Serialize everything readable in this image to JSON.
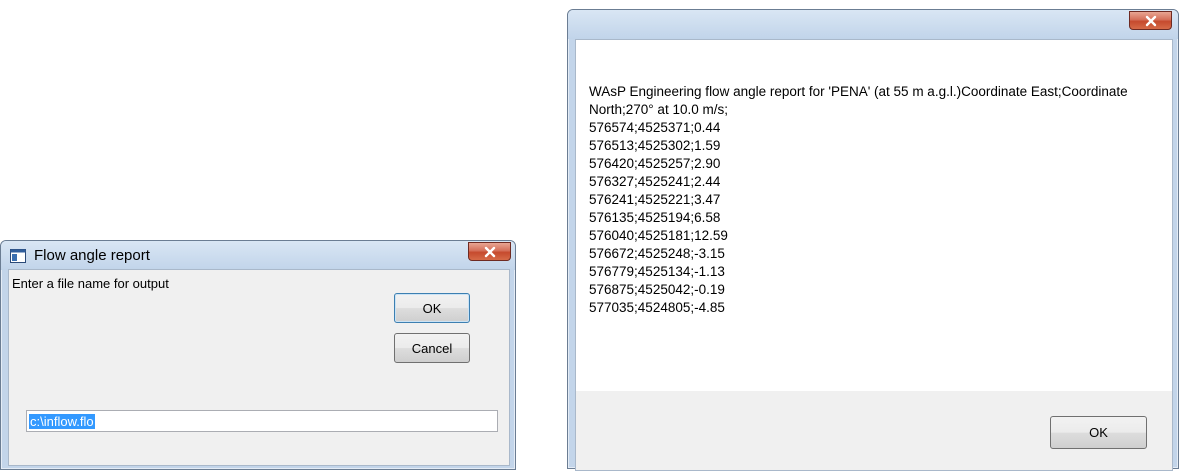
{
  "input_dialog": {
    "title": "Flow angle report",
    "prompt": "Enter a file name for output",
    "ok_label": "OK",
    "cancel_label": "Cancel",
    "file_value": "c:\\inflow.flo"
  },
  "report_window": {
    "title": "",
    "header": "WAsP Engineering flow angle report for 'PENA' (at 55 m a.g.l.)Coordinate East;Coordinate North;270° at 10.0 m/s;",
    "rows": [
      "576574;4525371;0.44",
      "576513;4525302;1.59",
      "576420;4525257;2.90",
      "576327;4525241;2.44",
      "576241;4525221;3.47",
      "576135;4525194;6.58",
      "576040;4525181;12.59",
      "576672;4525248;-3.15",
      "576779;4525134;-1.13",
      "576875;4525042;-0.19",
      "577035;4524805;-4.85"
    ],
    "ok_label": "OK"
  },
  "icons": {
    "app_icon": "application-window-icon",
    "close_icon": "close-icon"
  },
  "colors": {
    "titlebar": "#c6d7eb",
    "close_button": "#c64a2e",
    "selection": "#3399ff"
  }
}
